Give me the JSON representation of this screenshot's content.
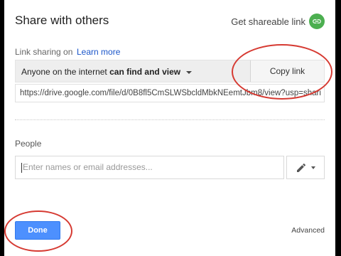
{
  "dialog": {
    "title": "Share with others",
    "shareable_link_label": "Get shareable link",
    "link_icon": "link-icon"
  },
  "link_sharing": {
    "label": "Link sharing on",
    "learn_more": "Learn more",
    "access_prefix": "Anyone on the internet ",
    "access_permission": "can find and view",
    "copy_button": "Copy link",
    "url": "https://drive.google.com/file/d/0B8fl5CmSLWSbcldMbkNEemtJbm8/view?usp=shari"
  },
  "people": {
    "label": "People",
    "placeholder": "Enter names or email addresses...",
    "edit_icon": "pencil-icon"
  },
  "footer": {
    "done_label": "Done",
    "advanced_label": "Advanced"
  },
  "colors": {
    "accent": "#4d90fe",
    "link_icon_bg": "#4caf50",
    "annotation": "#d63a32"
  }
}
